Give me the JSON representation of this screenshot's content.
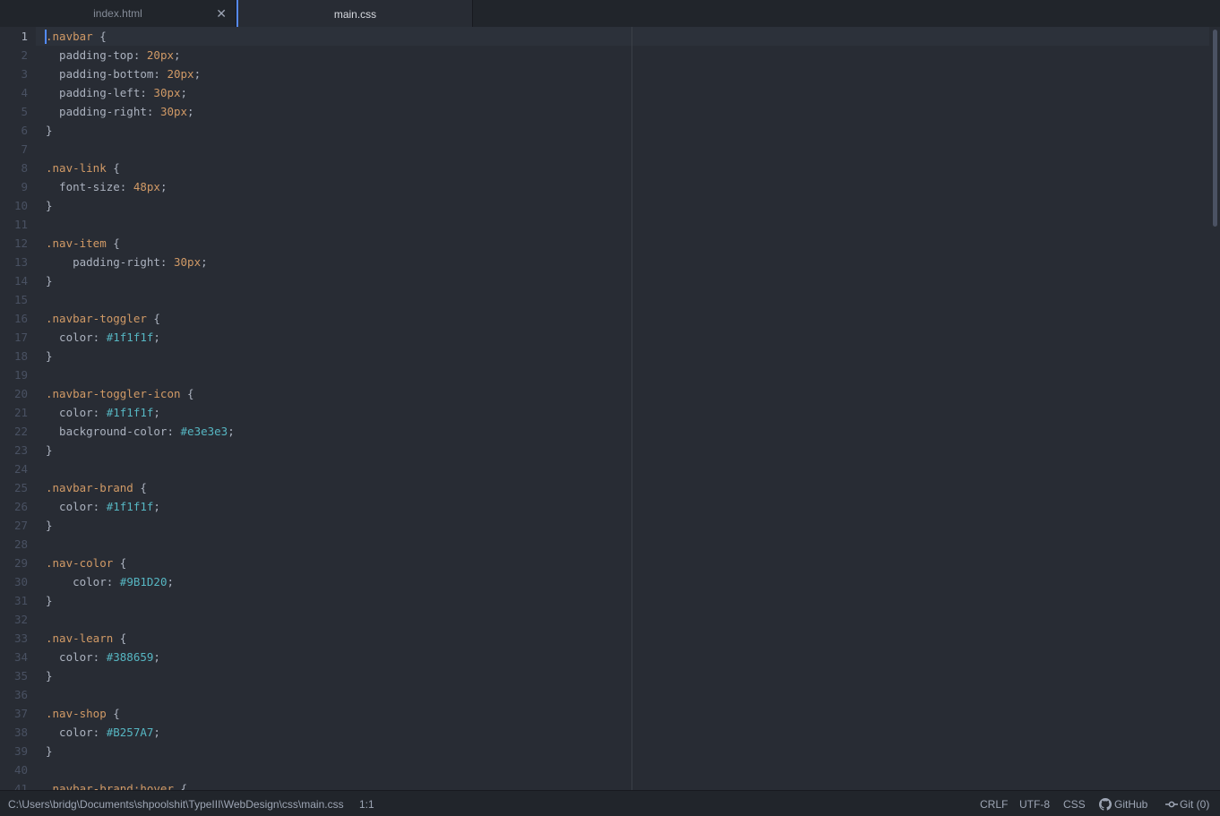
{
  "tabs": [
    {
      "label": "index.html",
      "active": false,
      "close_icon": "close-icon"
    },
    {
      "label": "main.css",
      "active": true
    }
  ],
  "editor": {
    "current_line": 1,
    "lines": [
      [
        {
          "t": ".navbar",
          "c": "sel"
        },
        {
          "t": " {",
          "c": "prop"
        }
      ],
      [
        {
          "t": "  padding-top: ",
          "c": "prop"
        },
        {
          "t": "20px",
          "c": "num"
        },
        {
          "t": ";",
          "c": "prop"
        }
      ],
      [
        {
          "t": "  padding-bottom: ",
          "c": "prop"
        },
        {
          "t": "20px",
          "c": "num"
        },
        {
          "t": ";",
          "c": "prop"
        }
      ],
      [
        {
          "t": "  padding-left: ",
          "c": "prop"
        },
        {
          "t": "30px",
          "c": "num"
        },
        {
          "t": ";",
          "c": "prop"
        }
      ],
      [
        {
          "t": "  padding-right: ",
          "c": "prop"
        },
        {
          "t": "30px",
          "c": "num"
        },
        {
          "t": ";",
          "c": "prop"
        }
      ],
      [
        {
          "t": "}",
          "c": "prop"
        }
      ],
      [],
      [
        {
          "t": ".nav-link",
          "c": "sel"
        },
        {
          "t": " {",
          "c": "prop"
        }
      ],
      [
        {
          "t": "  font-size: ",
          "c": "prop"
        },
        {
          "t": "48px",
          "c": "num"
        },
        {
          "t": ";",
          "c": "prop"
        }
      ],
      [
        {
          "t": "}",
          "c": "prop"
        }
      ],
      [],
      [
        {
          "t": ".nav-item",
          "c": "sel"
        },
        {
          "t": " {",
          "c": "prop"
        }
      ],
      [
        {
          "t": "    padding-right: ",
          "c": "prop"
        },
        {
          "t": "30px",
          "c": "num"
        },
        {
          "t": ";",
          "c": "prop"
        }
      ],
      [
        {
          "t": "}",
          "c": "prop"
        }
      ],
      [],
      [
        {
          "t": ".navbar-toggler",
          "c": "sel"
        },
        {
          "t": " {",
          "c": "prop"
        }
      ],
      [
        {
          "t": "  color: ",
          "c": "prop"
        },
        {
          "t": "#1f1f1f",
          "c": "hex"
        },
        {
          "t": ";",
          "c": "prop"
        }
      ],
      [
        {
          "t": "}",
          "c": "prop"
        }
      ],
      [],
      [
        {
          "t": ".navbar-toggler-icon",
          "c": "sel"
        },
        {
          "t": " {",
          "c": "prop"
        }
      ],
      [
        {
          "t": "  color: ",
          "c": "prop"
        },
        {
          "t": "#1f1f1f",
          "c": "hex"
        },
        {
          "t": ";",
          "c": "prop"
        }
      ],
      [
        {
          "t": "  background-color: ",
          "c": "prop"
        },
        {
          "t": "#e3e3e3",
          "c": "hex"
        },
        {
          "t": ";",
          "c": "prop"
        }
      ],
      [
        {
          "t": "}",
          "c": "prop"
        }
      ],
      [],
      [
        {
          "t": ".navbar-brand",
          "c": "sel"
        },
        {
          "t": " {",
          "c": "prop"
        }
      ],
      [
        {
          "t": "  color: ",
          "c": "prop"
        },
        {
          "t": "#1f1f1f",
          "c": "hex"
        },
        {
          "t": ";",
          "c": "prop"
        }
      ],
      [
        {
          "t": "}",
          "c": "prop"
        }
      ],
      [],
      [
        {
          "t": ".nav-color",
          "c": "sel"
        },
        {
          "t": " {",
          "c": "prop"
        }
      ],
      [
        {
          "t": "    color: ",
          "c": "prop"
        },
        {
          "t": "#9B1D20",
          "c": "hex"
        },
        {
          "t": ";",
          "c": "prop"
        }
      ],
      [
        {
          "t": "}",
          "c": "prop"
        }
      ],
      [],
      [
        {
          "t": ".nav-learn",
          "c": "sel"
        },
        {
          "t": " {",
          "c": "prop"
        }
      ],
      [
        {
          "t": "  color: ",
          "c": "prop"
        },
        {
          "t": "#388659",
          "c": "hex"
        },
        {
          "t": ";",
          "c": "prop"
        }
      ],
      [
        {
          "t": "}",
          "c": "prop"
        }
      ],
      [],
      [
        {
          "t": ".nav-shop",
          "c": "sel"
        },
        {
          "t": " {",
          "c": "prop"
        }
      ],
      [
        {
          "t": "  color: ",
          "c": "prop"
        },
        {
          "t": "#B257A7",
          "c": "hex"
        },
        {
          "t": ";",
          "c": "prop"
        }
      ],
      [
        {
          "t": "}",
          "c": "prop"
        }
      ],
      [],
      [
        {
          "t": ".navbar-brand:hover",
          "c": "sel"
        },
        {
          "t": " {",
          "c": "prop"
        }
      ]
    ]
  },
  "statusbar": {
    "file_path": "C:\\Users\\bridg\\Documents\\shpoolshit\\TypeIII\\WebDesign\\css\\main.css",
    "cursor_position": "1:1",
    "line_ending": "CRLF",
    "encoding": "UTF-8",
    "grammar": "CSS",
    "github_label": "GitHub",
    "git_label": "Git (0)"
  },
  "colors": {
    "selector": "#d19a66",
    "hex_value": "#56b6c2",
    "accent": "#568af2",
    "background": "#282c34"
  }
}
